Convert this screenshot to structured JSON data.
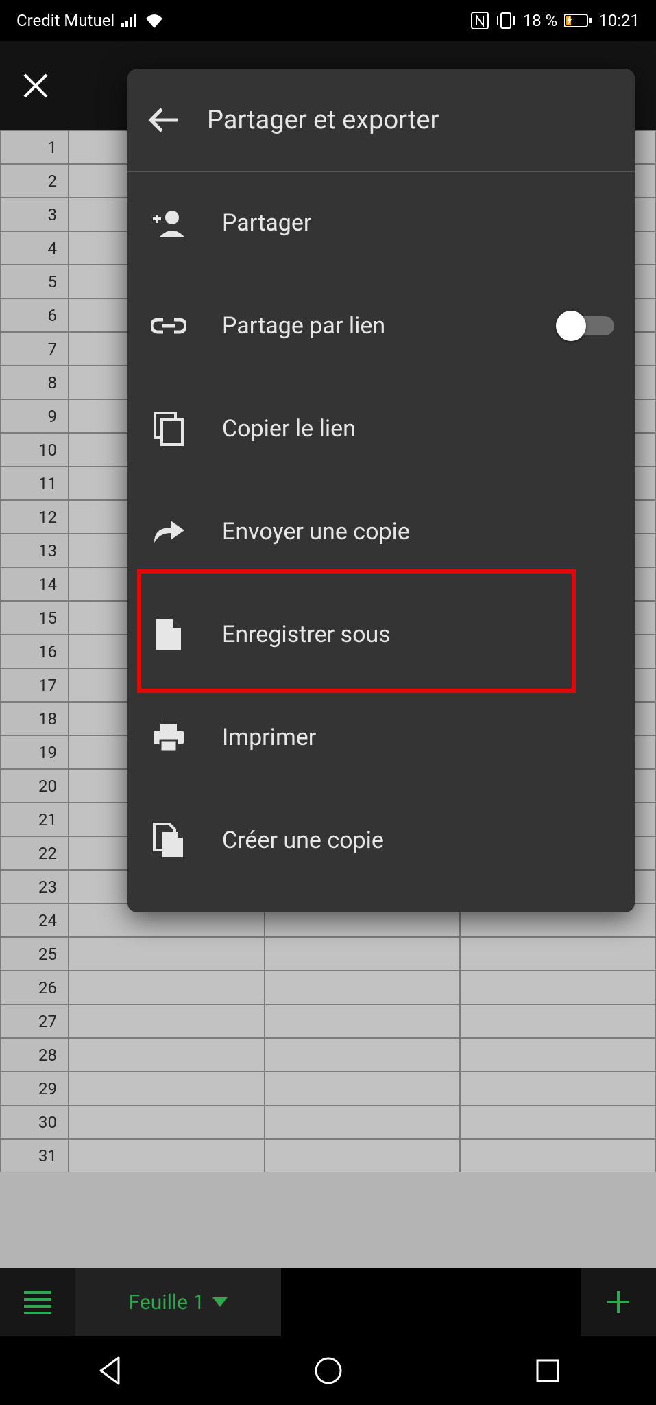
{
  "status": {
    "carrier": "Credit Mutuel",
    "battery": "18 %",
    "time": "10:21"
  },
  "popup": {
    "title": "Partager et exporter",
    "items": {
      "share": "Partager",
      "link_share": "Partage par lien",
      "copy_link": "Copier le lien",
      "send_copy": "Envoyer une copie",
      "save_as": "Enregistrer sous",
      "print": "Imprimer",
      "make_copy": "Créer une copie"
    }
  },
  "tabs": {
    "sheet1": "Feuille 1"
  },
  "rows": [
    "1",
    "2",
    "3",
    "4",
    "5",
    "6",
    "7",
    "8",
    "9",
    "10",
    "11",
    "12",
    "13",
    "14",
    "15",
    "16",
    "17",
    "18",
    "19",
    "20",
    "21",
    "22",
    "23",
    "24",
    "25",
    "26",
    "27",
    "28",
    "29",
    "30",
    "31"
  ]
}
